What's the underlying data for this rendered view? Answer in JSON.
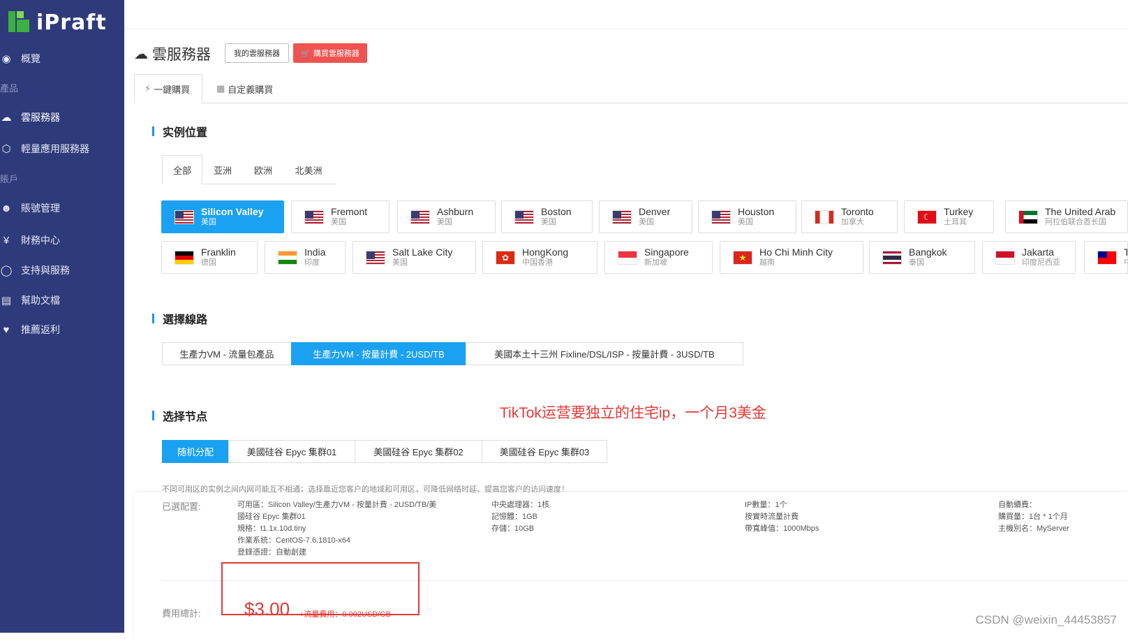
{
  "app": {
    "logo_text": "iPraft"
  },
  "sidebar": {
    "items": [
      {
        "label": "概覽",
        "icon": "dashboard-icon"
      },
      {
        "label": "產品",
        "section": true
      },
      {
        "label": "雲服務器",
        "icon": "cloud-server-icon"
      },
      {
        "label": "輕量應用服務器",
        "icon": "cube-icon"
      },
      {
        "label": "賬戶",
        "section": true
      },
      {
        "label": "賬號管理",
        "icon": "user-icon"
      },
      {
        "label": "財務中心",
        "icon": "yen-icon"
      },
      {
        "label": "支持與服務",
        "icon": "chat-icon"
      },
      {
        "label": "幫助文檔",
        "icon": "doc-icon"
      },
      {
        "label": "推薦返利",
        "icon": "heart-icon"
      }
    ]
  },
  "header": {
    "title": "雲服務器",
    "my_servers_label": "我的雲服務器",
    "buy_label": "購買雲服務器"
  },
  "purchase_tabs": [
    {
      "label": "一鍵購買",
      "active": true
    },
    {
      "label": "自定義購買",
      "active": false
    }
  ],
  "location": {
    "title": "实例位置",
    "region_tabs": [
      {
        "label": "全部",
        "active": true
      },
      {
        "label": "亚洲"
      },
      {
        "label": "欧洲"
      },
      {
        "label": "北美洲"
      }
    ],
    "items": [
      {
        "name": "Silicon Valley",
        "sub": "美国",
        "flag": "us",
        "active": true
      },
      {
        "name": "Fremont",
        "sub": "美国",
        "flag": "us"
      },
      {
        "name": "Ashburn",
        "sub": "美国",
        "flag": "us"
      },
      {
        "name": "Boston",
        "sub": "美国",
        "flag": "us"
      },
      {
        "name": "Denver",
        "sub": "美国",
        "flag": "us"
      },
      {
        "name": "Houston",
        "sub": "美国",
        "flag": "us"
      },
      {
        "name": "Toronto",
        "sub": "加拿大",
        "flag": "ca"
      },
      {
        "name": "Turkey",
        "sub": "土耳其",
        "flag": "tr"
      },
      {
        "name": "The United Arab",
        "sub": "阿拉伯联合酋长国",
        "flag": "ae"
      },
      {
        "name": "Franklin",
        "sub": "德国",
        "flag": "de"
      },
      {
        "name": "India",
        "sub": "印度",
        "flag": "in"
      },
      {
        "name": "Salt Lake City",
        "sub": "美国",
        "flag": "us"
      },
      {
        "name": "HongKong",
        "sub": "中国香港",
        "flag": "hk"
      },
      {
        "name": "Singapore",
        "sub": "新加坡",
        "flag": "sg"
      },
      {
        "name": "Ho Chi Minh City",
        "sub": "越南",
        "flag": "vn"
      },
      {
        "name": "Bangkok",
        "sub": "泰国",
        "flag": "th"
      },
      {
        "name": "Jakarta",
        "sub": "印度尼西亚",
        "flag": "id"
      },
      {
        "name": "Taipei",
        "sub": "中国台湾",
        "flag": "tw"
      }
    ]
  },
  "line": {
    "title": "選擇線路",
    "options": [
      {
        "label": "生產力VM - 流量包產品"
      },
      {
        "label": "生產力VM - 按量計費 - 2USD/TB",
        "active": true
      },
      {
        "label": "美國本土十三州 Fixline/DSL/ISP - 按量計費 - 3USD/TB"
      }
    ]
  },
  "annotation": "TikTok运营要独立的住宅ip，一个月3美金",
  "node": {
    "title": "选择节点",
    "options": [
      {
        "label": "随机分配",
        "active": true
      },
      {
        "label": "美國硅谷 Epyc 集群01"
      },
      {
        "label": "美國硅谷 Epyc 集群02"
      },
      {
        "label": "美國硅谷 Epyc 集群03"
      }
    ],
    "hint": "不同可用区的实例之间内网可能互不相通；选择靠近您客户的地域和可用区，可降低网络时延、提高您客户的访问速度！"
  },
  "summary": {
    "config_label": "已選配置:",
    "col1": [
      "可用區：Silicon Valley/生產力VM - 按量計費 - 2USD/TB/美",
      "國硅谷 Epyc 集群01",
      "規格：t1.1x.10d.tiny",
      "作業系統：CentOS-7.6.1810-x64",
      "登錄憑證：自動創建"
    ],
    "col2": [
      "中央處理器：1核",
      "記憶體：1GB",
      "存儲：10GB"
    ],
    "col3": [
      "IP數量：1个",
      "按實時流量計費",
      "帶寬峰值：1000Mbps"
    ],
    "col4": [
      "自動續費：",
      "購買量：1台 * 1个月",
      "主機別名：MyServer"
    ],
    "total_label": "費用總計:",
    "price": "$3.00",
    "traffic_fee": "+流量費用：0.002USD/GB"
  },
  "watermark": "CSDN @weixin_44453857",
  "colors": {
    "sidebar": "#2e3a7a",
    "accent": "#1ba1f2",
    "danger": "#ef5350",
    "annotation": "#e53935"
  }
}
